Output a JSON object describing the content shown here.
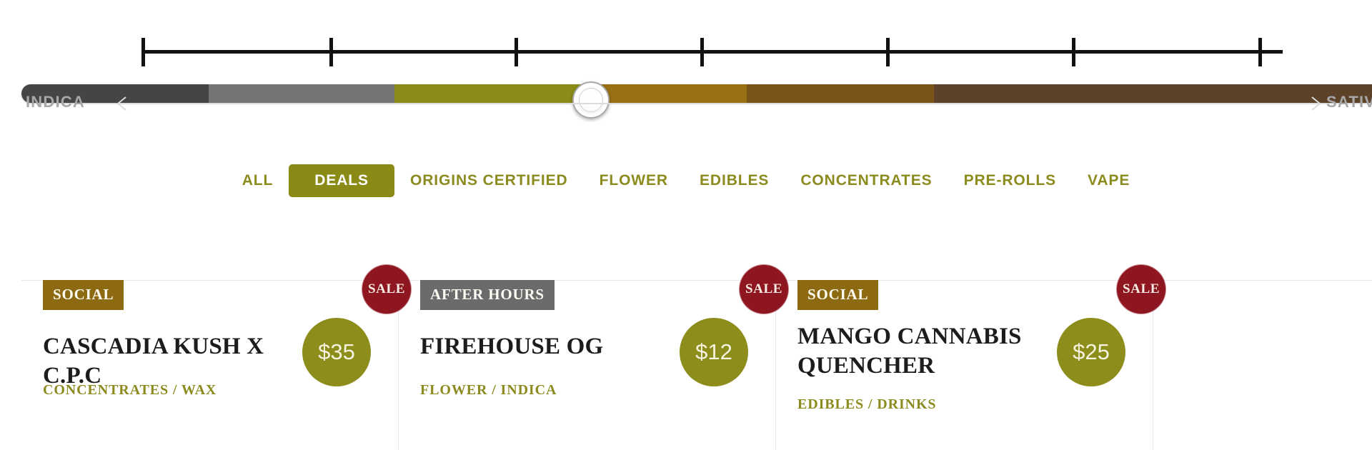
{
  "strain_slider": {
    "left_label": "INDICA",
    "right_label": "SATIVA",
    "left_arrow_icon": "arrow-left-icon",
    "right_arrow_icon": "arrow-right-icon",
    "handle_position_pct": 41.5,
    "ruler": {
      "tick_positions_pct": [
        0,
        16.5,
        32.7,
        49.0,
        65.3,
        81.6,
        98.0
      ]
    },
    "segments": [
      {
        "name": "indica-dark",
        "color": "#454545",
        "width_pct": 13.8
      },
      {
        "name": "indica-gray",
        "color": "#757575",
        "width_pct": 13.7
      },
      {
        "name": "hybrid-olive",
        "color": "#8b8b17",
        "width_pct": 13.7
      },
      {
        "name": "hybrid-gold",
        "color": "#9a7014",
        "width_pct": 12.2
      },
      {
        "name": "sativa-brown",
        "color": "#7a5418",
        "width_pct": 13.8
      },
      {
        "name": "sativa-dark-brown",
        "color": "#5c4228",
        "width_pct": 32.8
      }
    ]
  },
  "category_nav": {
    "items": [
      {
        "label": "ALL",
        "active": false
      },
      {
        "label": "DEALS",
        "active": true
      },
      {
        "label": "ORIGINS CERTIFIED",
        "active": false
      },
      {
        "label": "FLOWER",
        "active": false
      },
      {
        "label": "EDIBLES",
        "active": false
      },
      {
        "label": "CONCENTRATES",
        "active": false
      },
      {
        "label": "PRE-ROLLS",
        "active": false
      },
      {
        "label": "VAPE",
        "active": false
      }
    ],
    "active_color": "#8a8a17",
    "text_color": "#8b8b1f"
  },
  "products": [
    {
      "badge": "SOCIAL",
      "badge_style": "social",
      "title": "CASCADIA KUSH X C.P.C",
      "category": "CONCENTRATES / WAX",
      "price": "$35",
      "sale_label": "SALE",
      "on_sale": true,
      "two_line": false
    },
    {
      "badge": "AFTER HOURS",
      "badge_style": "afterhours",
      "title": "FIREHOUSE OG",
      "category": "FLOWER / INDICA",
      "price": "$12",
      "sale_label": "SALE",
      "on_sale": true,
      "two_line": false
    },
    {
      "badge": "SOCIAL",
      "badge_style": "social",
      "title": "MANGO CANNABIS QUENCHER",
      "category": "EDIBLES / DRINKS",
      "price": "$25",
      "sale_label": "SALE",
      "on_sale": true,
      "two_line": true
    }
  ],
  "colors": {
    "olive": "#8b8b1f",
    "olive_active": "#8a8a17",
    "badge_gold": "#8d6a12",
    "badge_gray": "#6b6b6b",
    "sale_red": "#8e1620",
    "title_dark": "#1c1c1c",
    "axis_gray": "#a8a8a8"
  }
}
